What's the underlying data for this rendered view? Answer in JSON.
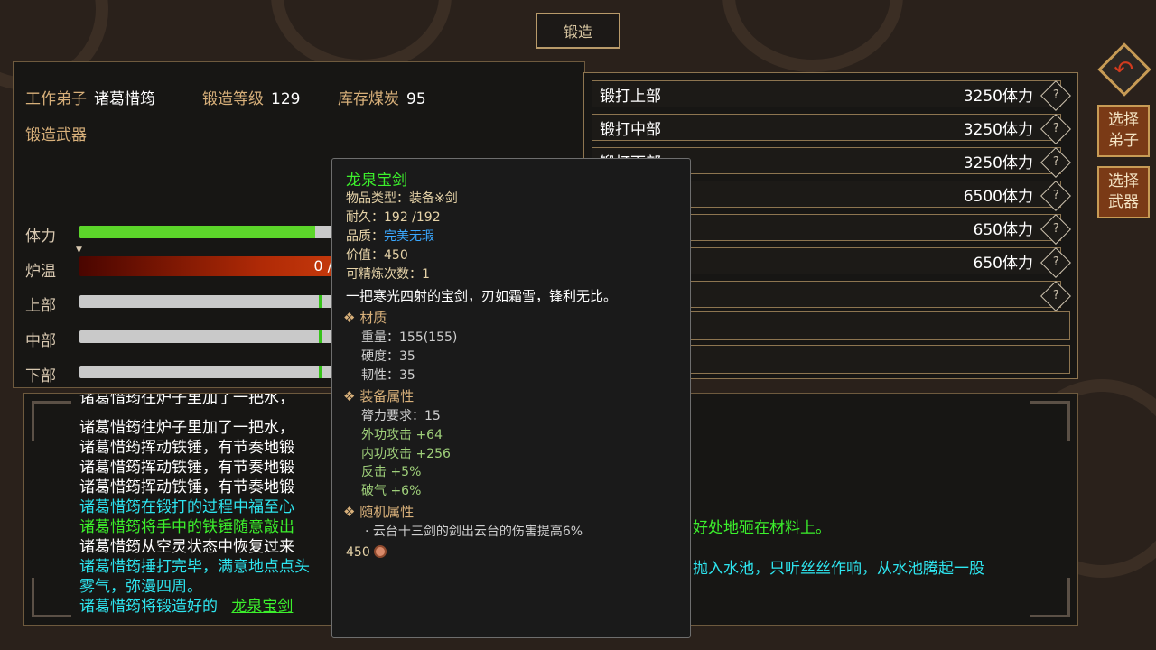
{
  "header": {
    "title": "锻造"
  },
  "info": {
    "worker_label": "工作弟子",
    "worker_value": "诸葛惜筠",
    "level_label": "锻造等级",
    "level_value": "129",
    "coal_label": "库存煤炭",
    "coal_value": "95",
    "weapon_label": "锻造武器"
  },
  "bars": {
    "stamina_label": "体力",
    "stamina_fraction": 0.9,
    "furnace_label": "炉温",
    "furnace_text": "0 /",
    "top_label": "上部",
    "middle_label": "中部",
    "bottom_label": "下部"
  },
  "forge_actions": [
    {
      "label": "锻打上部",
      "cost": "3250体力"
    },
    {
      "label": "锻打中部",
      "cost": "3250体力"
    },
    {
      "label": "锻打下部",
      "cost": "3250体力"
    },
    {
      "label": "",
      "cost": "6500体力"
    },
    {
      "label": "",
      "cost": "650体力"
    },
    {
      "label": "",
      "cost": "650体力"
    }
  ],
  "side_buttons": {
    "select_disciple": "选择弟子",
    "select_weapon": "选择武器"
  },
  "log": [
    {
      "text": "诸葛惜筠往炉子里加了一把水，",
      "color": "white"
    },
    {
      "text": "诸葛惜筠往炉子里加了一把水，",
      "color": "white"
    },
    {
      "text": "诸葛惜筠挥动铁锤，有节奏地锻",
      "color": "white"
    },
    {
      "text": "诸葛惜筠挥动铁锤，有节奏地锻",
      "color": "white"
    },
    {
      "text": "诸葛惜筠挥动铁锤，有节奏地锻",
      "color": "white"
    },
    {
      "text": "诸葛惜筠在锻打的过程中福至心",
      "color": "cyan"
    },
    {
      "text": "诸葛惜筠将手中的铁锤随意敲出",
      "color": "green"
    },
    {
      "text": "诸葛惜筠从空灵状态中恢复过来",
      "color": "white"
    },
    {
      "text": "诸葛惜筠捶打完毕，满意地点点头",
      "color": "cyan"
    },
    {
      "text": "雾气，弥漫四周。",
      "color": "cyan"
    },
    {
      "text": "诸葛惜筠将锻造好的",
      "color": "cyan"
    }
  ],
  "log_link": "龙泉宝剑",
  "log_right": [
    {
      "text": "好处地砸在材料上。",
      "color": "green"
    },
    {
      "text": "抛入水池，只听丝丝作响，从水池腾起一股",
      "color": "cyan"
    }
  ],
  "tooltip": {
    "name": "龙泉宝剑",
    "type": "物品类型：装备※剑",
    "durability": "耐久：192 /192",
    "quality_label": "品质：",
    "quality_value": "完美无瑕",
    "value": "价值：450",
    "refine": "可精炼次数：1",
    "desc": "一把寒光四射的宝剑，刃如霜雪，锋利无比。",
    "sec_material": "❖ 材质",
    "weight": "重量：155(155)",
    "hardness": "硬度：35",
    "toughness": "韧性：35",
    "sec_equip": "❖ 装备属性",
    "strength_req": "膂力要求：15",
    "ext_attack": "外功攻击 +64",
    "int_attack": "内功攻击 +256",
    "counter": "反击 +5%",
    "pierce": "破气 +6%",
    "sec_random": "❖ 随机属性",
    "random_attr": "· 云台十三剑的剑出云台的伤害提高6%",
    "price": "450"
  }
}
